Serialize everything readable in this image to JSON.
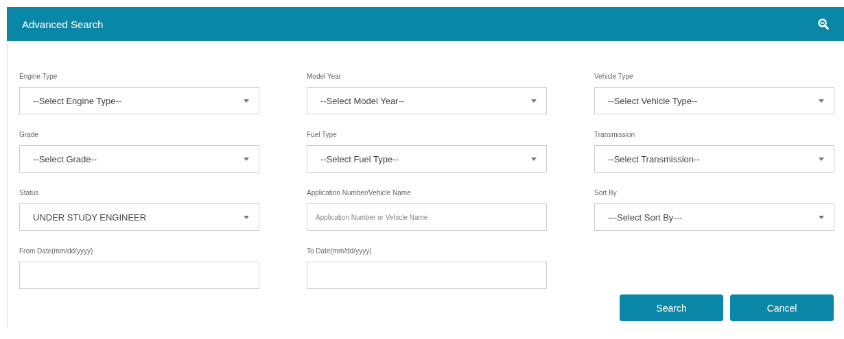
{
  "panel": {
    "title": "Advanced Search"
  },
  "fields": [
    {
      "label": "Engine Type",
      "kind": "select",
      "value": "--Select Engine Type--"
    },
    {
      "label": "Model Year",
      "kind": "select",
      "value": "--Select Model Year--"
    },
    {
      "label": "Vehicle Type",
      "kind": "select",
      "value": "--Select Vehicle Type--"
    },
    {
      "label": "Grade",
      "kind": "select",
      "value": "--Select Grade--"
    },
    {
      "label": "Fuel Type",
      "kind": "select",
      "value": "--Select Fuel Type--"
    },
    {
      "label": "Transmission",
      "kind": "select",
      "value": "--Select Transmission--"
    },
    {
      "label": "Status",
      "kind": "select",
      "value": "UNDER STUDY ENGINEER"
    },
    {
      "label": "Application Number/Vehicle Name",
      "kind": "text",
      "placeholder": "Application Number or Vehicle Name"
    },
    {
      "label": "Sort By",
      "kind": "select",
      "value": "---Select Sort By---"
    },
    {
      "label": "From Date(mm/dd/yyyy)",
      "kind": "text"
    },
    {
      "label": "To Date(mm/dd/yyyy)",
      "kind": "text"
    }
  ],
  "buttons": [
    "Search",
    "Cancel"
  ]
}
